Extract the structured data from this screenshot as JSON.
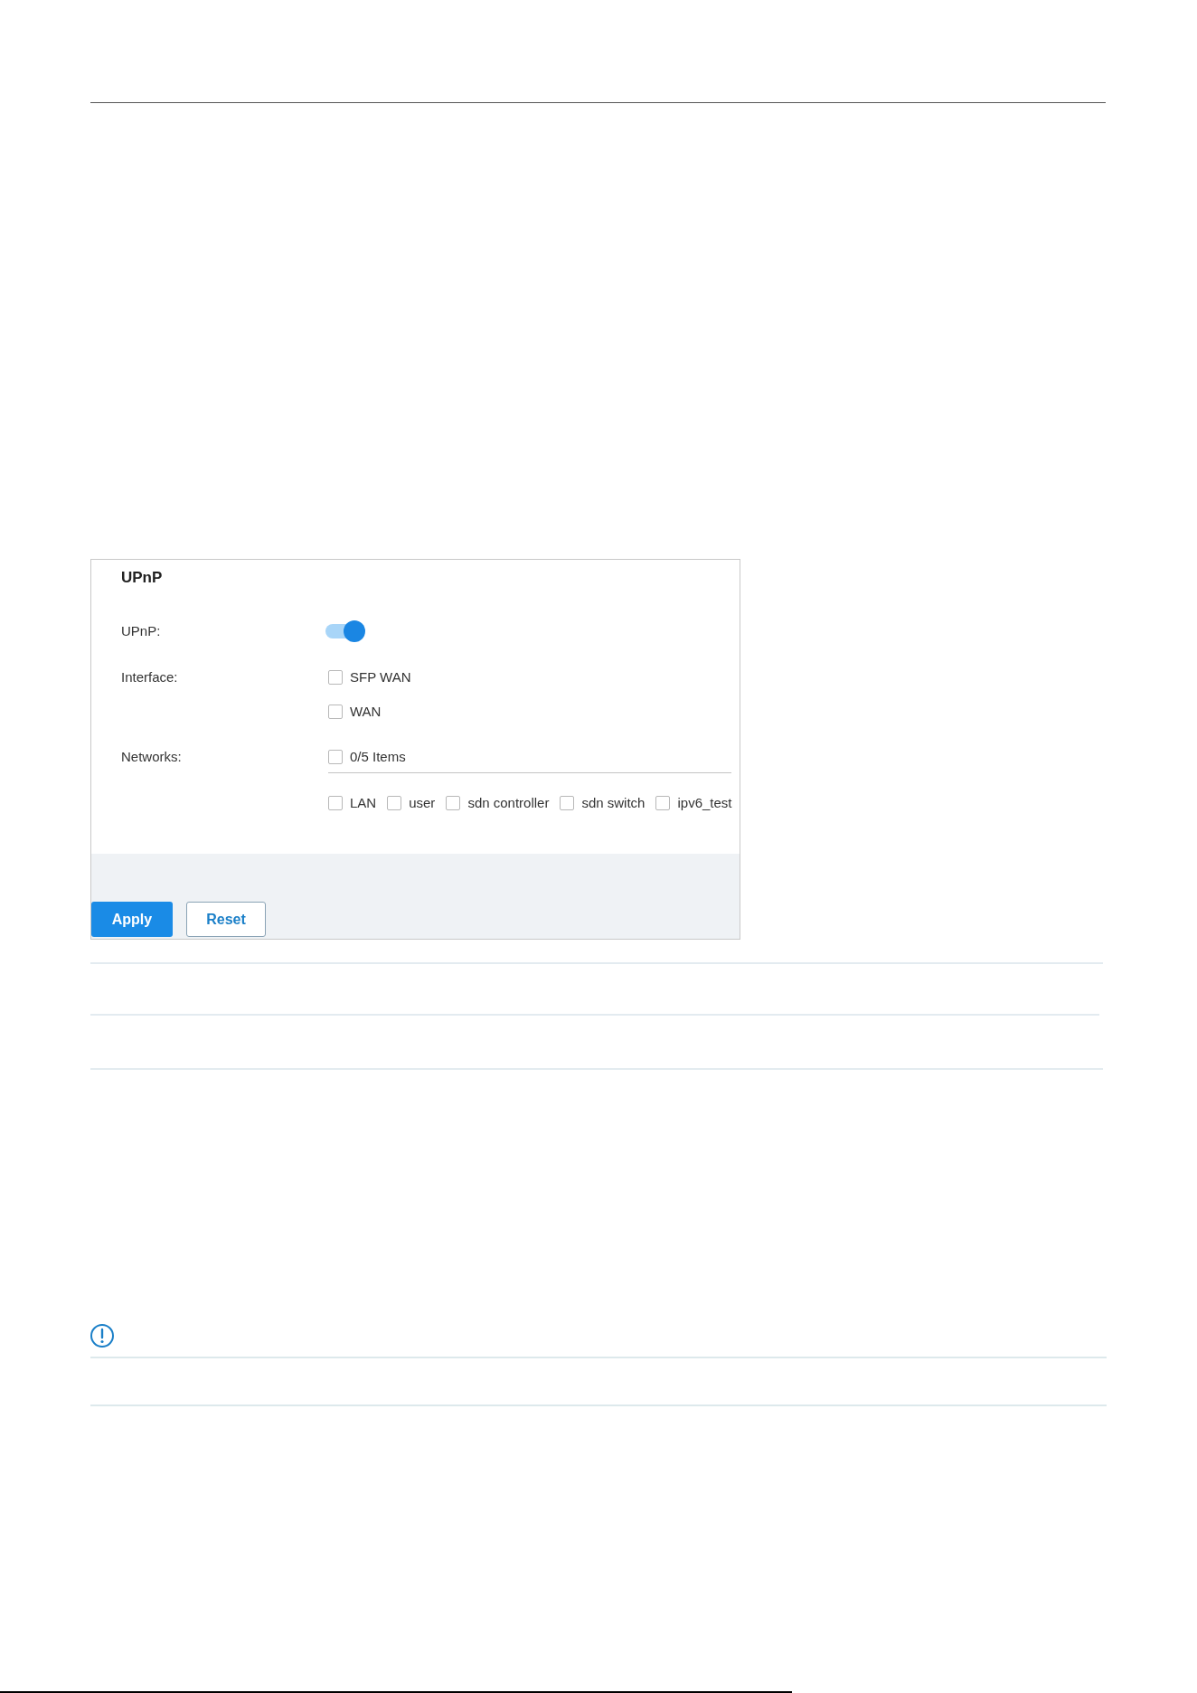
{
  "panel": {
    "title": "UPnP",
    "fields": [
      {
        "kind": "toggle",
        "label": "UPnP:",
        "on": true
      },
      {
        "kind": "checklist",
        "label": "Interface:",
        "options": [
          {
            "label": "SFP WAN",
            "checked": false
          },
          {
            "label": "WAN",
            "checked": false
          }
        ]
      },
      {
        "kind": "transfer",
        "label": "Networks:",
        "summary": {
          "label": "0/5 Items",
          "checked": false
        },
        "options": [
          {
            "label": "LAN",
            "checked": false
          },
          {
            "label": "user",
            "checked": false
          },
          {
            "label": "sdn controller",
            "checked": false
          },
          {
            "label": "sdn switch",
            "checked": false
          },
          {
            "label": "ipv6_test",
            "checked": false
          }
        ]
      }
    ],
    "buttons": [
      {
        "kind": "primary",
        "label": "Apply"
      },
      {
        "kind": "secondary",
        "label": "Reset"
      }
    ]
  }
}
